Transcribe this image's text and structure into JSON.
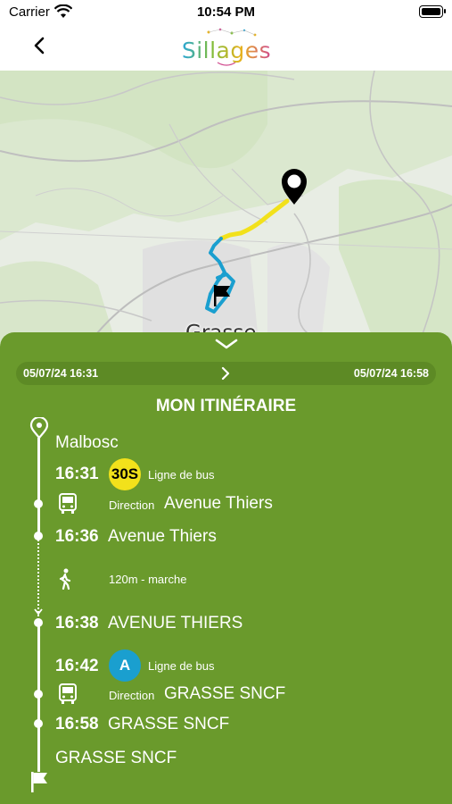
{
  "status_bar": {
    "carrier": "Carrier",
    "time": "10:54 PM"
  },
  "header": {
    "logo_text": "Sillages"
  },
  "map": {
    "city_label": "Grasse"
  },
  "itinerary": {
    "start_datetime": "05/07/24 16:31",
    "end_datetime": "05/07/24 16:58",
    "title": "MON ITINÉRAIRE",
    "origin": "Malbosc",
    "legs": [
      {
        "depart_time": "16:31",
        "line_code": "30S",
        "line_color": "#f2e11b",
        "line_text_color": "#000000",
        "mode_label": "Ligne de bus",
        "direction_label": "Direction",
        "direction": "Avenue Thiers",
        "arrive_time": "16:36",
        "arrive_stop": "Avenue Thiers"
      },
      {
        "walk_label": "120m - marche"
      },
      {
        "depart_time": "16:38",
        "depart_stop": "AVENUE THIERS"
      },
      {
        "depart_time": "16:42",
        "line_code": "A",
        "line_color": "#1a9fcf",
        "line_text_color": "#ffffff",
        "mode_label": "Ligne de bus",
        "direction_label": "Direction",
        "direction": "GRASSE SNCF",
        "arrive_time": "16:58",
        "arrive_stop": "GRASSE SNCF"
      }
    ],
    "destination": "GRASSE SNCF"
  },
  "colors": {
    "sheet": "#6a9a2c",
    "route_bus_30S": "#f2e11b",
    "route_bus_A": "#1a9fcf"
  }
}
